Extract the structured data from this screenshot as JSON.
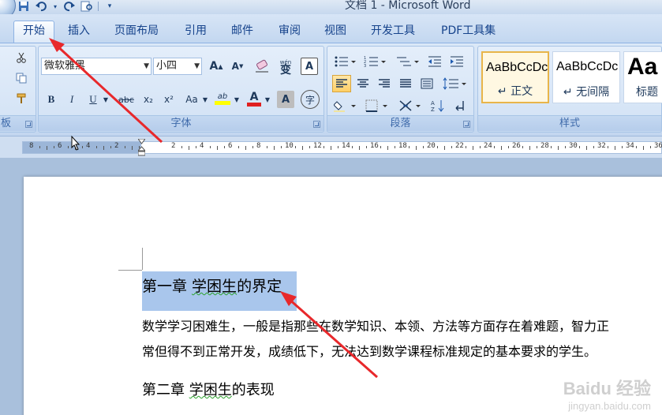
{
  "window": {
    "title": "文档 1 - Microsoft Word"
  },
  "qat": {
    "icons": [
      "save-icon",
      "undo-icon",
      "redo-icon",
      "print-preview-icon"
    ]
  },
  "tabs": [
    {
      "label": "开始",
      "active": true
    },
    {
      "label": "插入"
    },
    {
      "label": "页面布局"
    },
    {
      "label": "引用"
    },
    {
      "label": "邮件"
    },
    {
      "label": "审阅"
    },
    {
      "label": "视图"
    },
    {
      "label": "开发工具"
    },
    {
      "label": "PDF工具集"
    }
  ],
  "ribbon": {
    "clipboard": {
      "label": "板"
    },
    "font": {
      "label": "字体",
      "font_name": "微软雅黑",
      "font_size": "小四",
      "grow": "A",
      "shrink": "A",
      "phonetic": "wén",
      "phonetic_char": "变",
      "char_border": "A",
      "bold": "B",
      "italic": "I",
      "underline": "U",
      "strike": "abc",
      "subscript": "x₂",
      "superscript": "x²",
      "case": "Aa",
      "highlight": "ab",
      "font_color": "A",
      "char_shading": "A",
      "enclose": "字"
    },
    "paragraph": {
      "label": "段落"
    },
    "styles": {
      "label": "样式",
      "items": [
        {
          "sample": "AaBbCcDc",
          "name": "↵ 正文"
        },
        {
          "sample": "AaBbCcDc",
          "name": "↵ 无间隔"
        },
        {
          "sample": "Aa",
          "name": "标题"
        }
      ]
    }
  },
  "ruler": {
    "labels": [
      "8",
      "6",
      "4",
      "2",
      "2",
      "4",
      "6",
      "8",
      "10",
      "12",
      "14",
      "16",
      "18",
      "20",
      "22",
      "24",
      "26",
      "28",
      "30",
      "32",
      "34",
      "36"
    ]
  },
  "document": {
    "heading1": "第一章 学困生的界定",
    "heading1_underlined": "学困生",
    "para1_line1": "数学学习困难生，一般是指那些在数学知识、本领、方法等方面存在着难题，智力正",
    "para1_line2": "常但得不到正常开发，成绩低下，无法达到数学课程标准规定的基本要求的学生。",
    "heading2_prefix": "第二章 ",
    "heading2_underlined": "学困生",
    "heading2_suffix": "的表现"
  },
  "watermark": {
    "brand": "Baidu 经验",
    "url": "jingyan.baidu.com"
  },
  "colors": {
    "annotation_arrow": "#e8282b",
    "selection": "#a9c6ec",
    "ribbon": "#d5e4f6"
  }
}
